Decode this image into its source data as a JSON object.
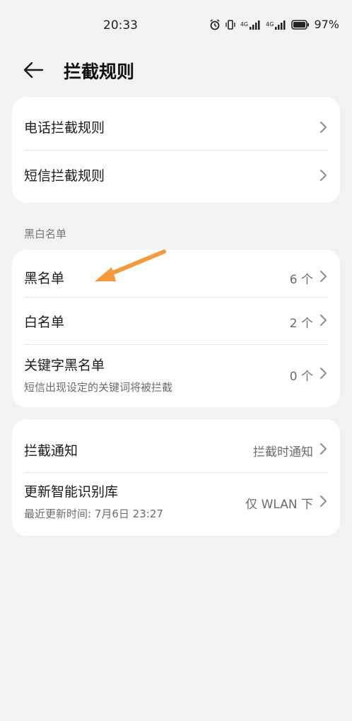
{
  "status_bar": {
    "time": "20:33",
    "battery": "97%",
    "net1": "4G",
    "net2": "4G"
  },
  "header": {
    "title": "拦截规则"
  },
  "rules_card": {
    "call_rules": "电话拦截规则",
    "sms_rules": "短信拦截规则"
  },
  "lists_section": {
    "label": "黑白名单",
    "blacklist": {
      "title": "黑名单",
      "value": "6 个"
    },
    "whitelist": {
      "title": "白名单",
      "value": "2 个"
    },
    "keyword_blacklist": {
      "title": "关键字黑名单",
      "subtitle": "短信出现设定的关键词将被拦截",
      "value": "0 个"
    }
  },
  "settings_card": {
    "notification": {
      "title": "拦截通知",
      "value": "拦截时通知"
    },
    "update_library": {
      "title": "更新智能识别库",
      "subtitle": "最近更新时间: 7月6日 23:27",
      "value": "仅 WLAN 下"
    }
  },
  "colors": {
    "annotation_arrow": "#f59a3c"
  }
}
